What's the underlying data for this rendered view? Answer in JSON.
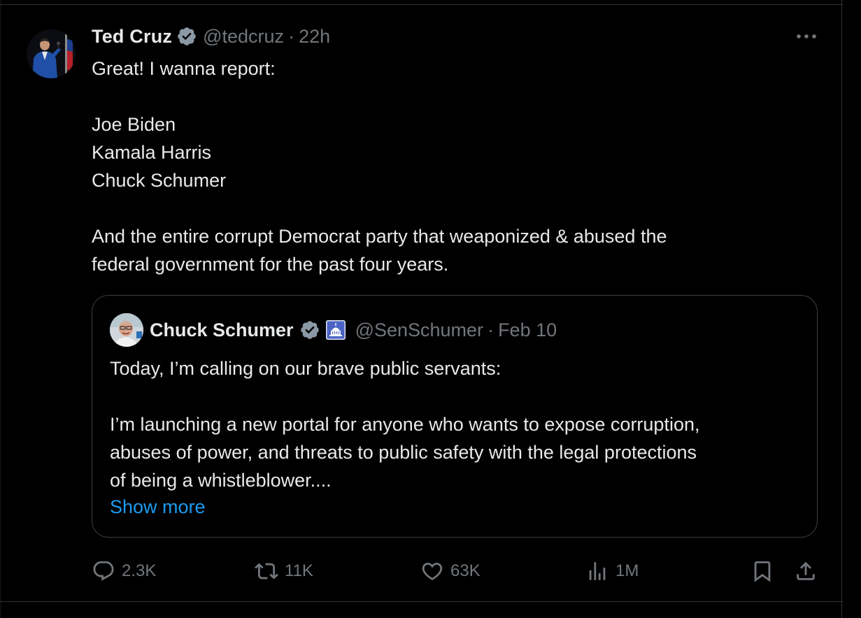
{
  "tweet": {
    "author": {
      "name": "Ted Cruz",
      "handle": "@tedcruz",
      "avatar_icon": "ted-cruz-avatar"
    },
    "separator": "·",
    "time": "22h",
    "text_lines": [
      "Great! I wanna report:",
      "",
      "Joe Biden",
      "Kamala Harris",
      "Chuck Schumer",
      "",
      "And the entire corrupt Democrat party that weaponized & abused the",
      "federal government for the past four years."
    ],
    "quoted": {
      "author": {
        "name": "Chuck Schumer",
        "handle": "@SenSchumer",
        "avatar_icon": "chuck-schumer-avatar"
      },
      "separator": "·",
      "time": "Feb 10",
      "text_lines": [
        "Today, I’m calling on our brave public servants:",
        "",
        "I’m launching a new portal for anyone who wants to expose corruption,",
        "abuses of power, and threats to public safety with the legal protections",
        "of being a whistleblower...."
      ],
      "show_more_label": "Show more"
    },
    "actions": {
      "replies": "2.3K",
      "reposts": "11K",
      "likes": "63K",
      "views": "1M"
    }
  },
  "colors": {
    "background": "#000000",
    "text_primary": "#e7e9ea",
    "text_secondary": "#71767b",
    "link": "#1d9bf0",
    "verified_badge": "#8b98a5",
    "border": "#2f3336"
  }
}
